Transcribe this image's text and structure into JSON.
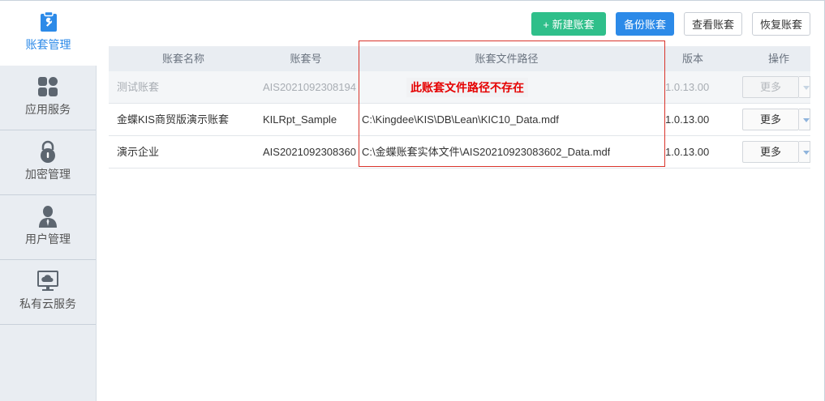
{
  "sidebar": {
    "items": [
      {
        "label": "账套管理",
        "icon": "clipboard-wrench-icon",
        "active": true
      },
      {
        "label": "应用服务",
        "icon": "grid-apps-icon",
        "active": false
      },
      {
        "label": "加密管理",
        "icon": "lock-icon",
        "active": false
      },
      {
        "label": "用户管理",
        "icon": "user-icon",
        "active": false
      },
      {
        "label": "私有云服务",
        "icon": "cloud-monitor-icon",
        "active": false
      }
    ]
  },
  "toolbar": {
    "new_label": "+ 新建账套",
    "backup_label": "备份账套",
    "view_label": "查看账套",
    "restore_label": "恢复账套"
  },
  "table": {
    "columns": [
      "账套名称",
      "账套号",
      "账套文件路径",
      "版本",
      "操作"
    ],
    "rows": [
      {
        "name": "测试账套",
        "number": "AIS2021092308194",
        "path": "",
        "path_error": "此账套文件路径不存在",
        "version": "1.0.13.00",
        "action": "更多",
        "disabled": true
      },
      {
        "name": "金蝶KIS商贸版演示账套",
        "number": "KILRpt_Sample",
        "path": "C:\\Kingdee\\KIS\\DB\\Lean\\KIC10_Data.mdf",
        "path_error": "",
        "version": "1.0.13.00",
        "action": "更多",
        "disabled": false
      },
      {
        "name": "演示企业",
        "number": "AIS2021092308360",
        "path": "C:\\金蝶账套实体文件\\AIS20210923083602_Data.mdf",
        "path_error": "",
        "version": "1.0.13.00",
        "action": "更多",
        "disabled": false
      }
    ]
  },
  "colors": {
    "accent_blue": "#2c8ae8",
    "accent_green": "#2fbf8a",
    "error_red": "#e50000",
    "highlight_border": "#d9342b"
  }
}
